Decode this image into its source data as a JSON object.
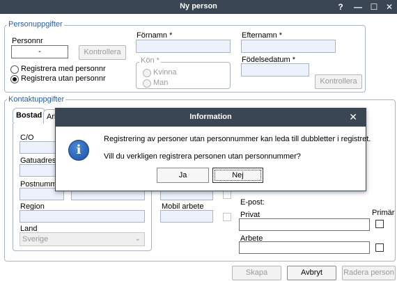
{
  "window": {
    "title": "Ny person",
    "controls": {
      "help": "?",
      "minimize": "—",
      "maximize": "☐",
      "close": "✕"
    }
  },
  "personuppgifter": {
    "legend": "Personuppgifter",
    "personnr_label": "Personnr",
    "personnr_value": "-",
    "kontrollera_label": "Kontrollera",
    "radio_with": "Registrera med personnr",
    "radio_without": "Registrera utan personnr",
    "fornamn_label": "Förnamn *",
    "efternamn_label": "Efternamn *",
    "kon_legend": "Kön *",
    "kon_kvinna": "Kvinna",
    "kon_man": "Man",
    "fodelsedatum_label": "Födelsedatum *",
    "kontrollera2_label": "Kontrollera"
  },
  "kontaktuppgifter": {
    "legend": "Kontaktuppgifter",
    "tabs": {
      "bostad": "Bostad",
      "arbete": "Arb"
    },
    "co_label": "C/O",
    "gatuadress_label": "Gatuadress",
    "postnummer_label": "Postnummer",
    "region_label": "Region",
    "land_label": "Land",
    "land_value": "Sverige",
    "mobil_arbete_label": "Mobil arbete",
    "epost_label": "E-post:",
    "privat_label": "Privat",
    "primar_label": "Primär",
    "arbete_label": "Arbete"
  },
  "footer": {
    "skapa": "Skapa",
    "avbryt": "Avbryt",
    "radera": "Radera person"
  },
  "dialog": {
    "title": "Information",
    "close": "✕",
    "icon_letter": "i",
    "line1": "Registrering av personer utan personnummer kan leda till dubbletter i registret.",
    "line2": "Vill du verkligen registrera personen utan personnummer?",
    "yes_label": "Ja",
    "no_label": "Nej"
  }
}
